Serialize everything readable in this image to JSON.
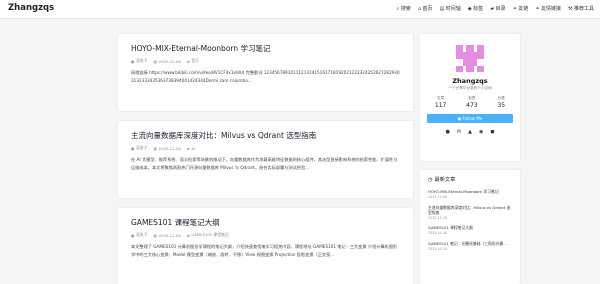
{
  "header": {
    "brand": "Zhangzqs",
    "nav": [
      {
        "icon": "search-icon",
        "glyph": "⌕",
        "label": "搜索"
      },
      {
        "icon": "home-icon",
        "glyph": "⌂",
        "label": "首页"
      },
      {
        "icon": "archive-icon",
        "glyph": "▤",
        "label": "时间轴"
      },
      {
        "icon": "tag-icon",
        "glyph": "◆",
        "label": "标签"
      },
      {
        "icon": "folder-icon",
        "glyph": "▰",
        "label": "目录"
      },
      {
        "icon": "link-icon",
        "glyph": "⚭",
        "label": "友链"
      },
      {
        "icon": "link-alt-icon",
        "glyph": "⚭",
        "label": "友情链接"
      },
      {
        "icon": "tools-icon",
        "glyph": "⚒",
        "label": "推荐工具"
      }
    ]
  },
  "posts": [
    {
      "title": "HOYO-MIX-Eternal-Moonborn 学习笔记",
      "author": "吴张子",
      "date": "2025-12-08",
      "category": "音乐",
      "excerpt": "网络链接 https://www.bilibili.com/video/BV1CF4x1e9Xd 完整歌词 1234567891011121314151617181920212223242526272829303132333435363738394041424344Dormi zam columba..."
    },
    {
      "title": "主流向量数据库深度对比：Milvus vs Qdrant 选型指南",
      "author": "吴张子",
      "date": "2025-11-26",
      "category": "AI",
      "excerpt": "在 AI 大模型、推荐系统、语义检索等场景的推动下，向量数据库作为承载高维特征数据的核心组件，其选型直接影响系统的检索性能、扩展性与运维成本。本文将聚焦两款热门开源向量数据库 Milvus 与 Qdrant，结合实际部署与测试经验..."
    },
    {
      "title": "GAMES101 课程笔记大纲",
      "author": "吴张子",
      "date": "2025-11-06",
      "category": "GAMES101 课程笔记",
      "excerpt": "本文整理了 GAMES101 计算机图形学课程的笔记大纲，介绍快速查找笔学习相关内容，课程地址 GAMES101 笔记 - 三大变换 介绍计算机图形学中的三大核心变换：Model 模型变换（缩放、旋转、平移）View 视图变换 Projection 投影变换（正交投..."
    }
  ],
  "profile": {
    "name": "Zhangzqs",
    "bio": "一个分享与记录的个人空间",
    "stats": [
      {
        "label": "文章",
        "value": "117"
      },
      {
        "label": "标签",
        "value": "473"
      },
      {
        "label": "分类",
        "value": "35"
      }
    ],
    "follow_label": "Follow Me",
    "socials": [
      {
        "icon": "github-icon",
        "glyph": "●"
      },
      {
        "icon": "email-icon",
        "glyph": "✉"
      },
      {
        "icon": "qq-icon",
        "glyph": "▲"
      },
      {
        "icon": "wechat-icon",
        "glyph": "◉"
      },
      {
        "icon": "rss-icon",
        "glyph": "◼"
      }
    ]
  },
  "recent": {
    "title": "最新文章",
    "items": [
      {
        "title": "HOYO-MIX-Eternal-Moonborn 学习笔记",
        "date": "2025-12-08"
      },
      {
        "title": "主流向量数据库深度对比：Milvus vs Qdrant 选型指南",
        "date": "2025-11-26"
      },
      {
        "title": "GAMES101 课程笔记大纲",
        "date": "2025-11-06"
      },
      {
        "title": "GAMES101 笔记 - 光栅化基础（三角形光栅...",
        "date": "2025-10-15"
      }
    ]
  },
  "colors": {
    "accent": "#49b1f5",
    "avatar": "#e38ee0"
  }
}
